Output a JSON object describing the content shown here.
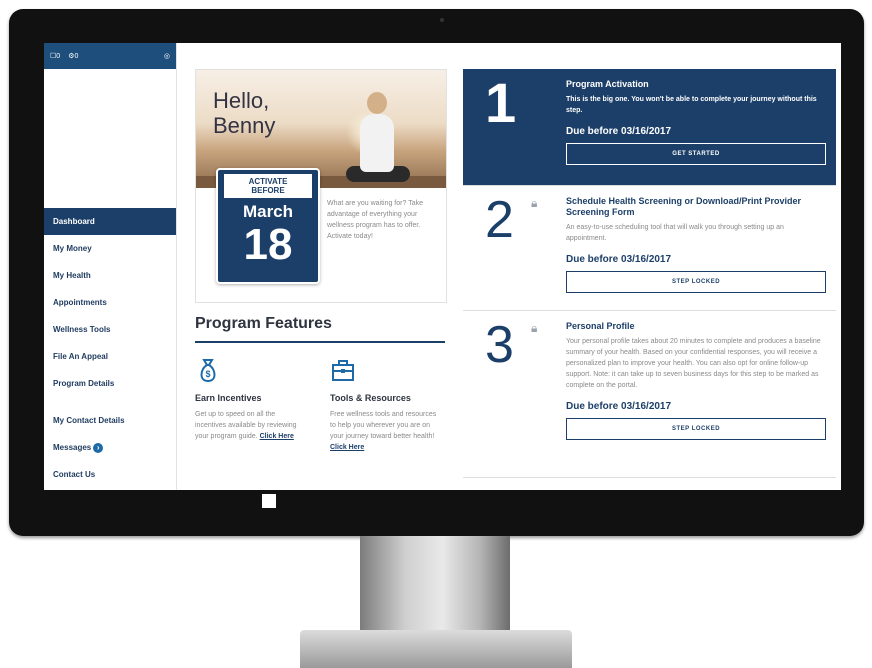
{
  "sidebar": {
    "top_icons": [
      "0",
      "0"
    ],
    "items": [
      {
        "label": "Dashboard",
        "active": true
      },
      {
        "label": "My Money"
      },
      {
        "label": "My Health"
      },
      {
        "label": "Appointments"
      },
      {
        "label": "Wellness Tools"
      },
      {
        "label": "File An Appeal"
      },
      {
        "label": "Program Details"
      }
    ],
    "secondary": [
      {
        "label": "My Contact Details"
      },
      {
        "label": "Messages"
      },
      {
        "label": "Contact Us"
      }
    ]
  },
  "hero": {
    "greeting_line1": "Hello,",
    "greeting_line2": "Benny",
    "activate_line1": "ACTIVATE",
    "activate_line2": "BEFORE",
    "month": "March",
    "day": "18",
    "text": "What are you waiting for? Take advantage of everything your wellness program has to offer. Activate today!"
  },
  "features": {
    "title": "Program Features",
    "items": [
      {
        "icon": "money-bag-icon",
        "title": "Earn Incentives",
        "text": "Get up to speed on all the incentives available by reviewing your program guide.",
        "link": "Click Here"
      },
      {
        "icon": "toolbox-icon",
        "title": "Tools & Resources",
        "text": "Free wellness tools and resources to help you wherever you are on your journey toward better health!",
        "link": "Click Here"
      }
    ]
  },
  "steps": [
    {
      "num": "1",
      "title": "Program Activation",
      "desc": "This is the big one. You won't be able to complete your journey without this step.",
      "due": "Due before 03/16/2017",
      "button": "GET STARTED",
      "locked": false
    },
    {
      "num": "2",
      "title": "Schedule Health Screening or Download/Print Provider Screening Form",
      "desc": "An easy-to-use scheduling tool that will walk you through setting up an appointment.",
      "due": "Due before 03/16/2017",
      "button": "STEP LOCKED",
      "locked": true
    },
    {
      "num": "3",
      "title": "Personal Profile",
      "desc": "Your personal profile takes about 20 minutes to complete and produces a baseline summary of your health. Based on your confidential responses, you will receive a personalized plan to improve your health. You can also opt for online follow-up support. Note: it can take up to seven business days for this step to be marked as complete on the portal.",
      "due": "Due before 03/16/2017",
      "button": "STEP LOCKED",
      "locked": true
    }
  ],
  "colors": {
    "navy": "#1c3f69",
    "accent": "#1e6aa8"
  }
}
